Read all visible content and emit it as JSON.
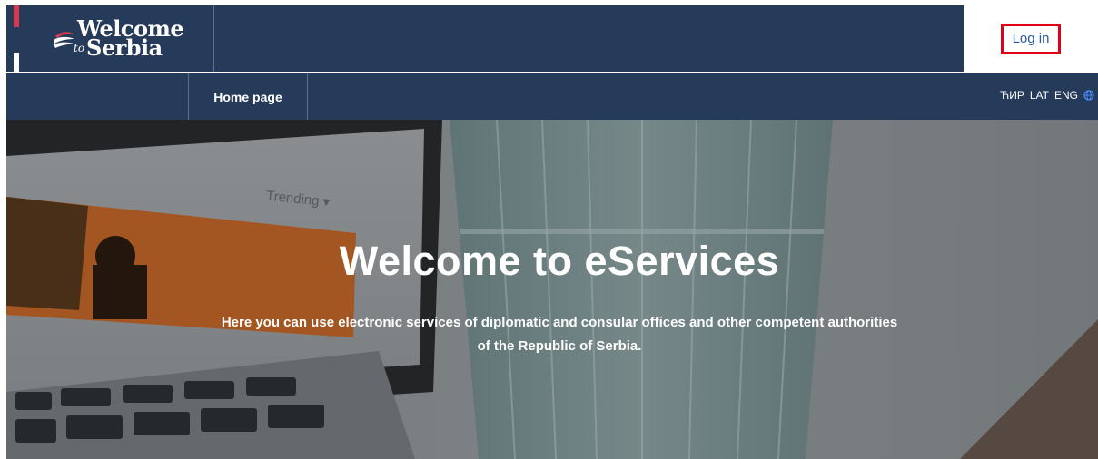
{
  "header": {
    "logo": {
      "line1": "Welcome",
      "to": "to",
      "line2": "Serbia"
    },
    "login_label": "Log in"
  },
  "nav": {
    "home_label": "Home page",
    "languages": [
      "ЋИР",
      "LAT",
      "ENG"
    ],
    "globe_icon": "globe-icon"
  },
  "hero": {
    "background_text": "Trending",
    "title": "Welcome to eServices",
    "subtitle": "Here you can use electronic services of diplomatic and consular offices and other competent authorities of the Republic of Serbia."
  },
  "colors": {
    "navy": "#263a59",
    "login_border": "#e0001a",
    "login_text": "#2c5aa0",
    "flag_red": "#d9394c",
    "globe": "#4a8cff"
  }
}
